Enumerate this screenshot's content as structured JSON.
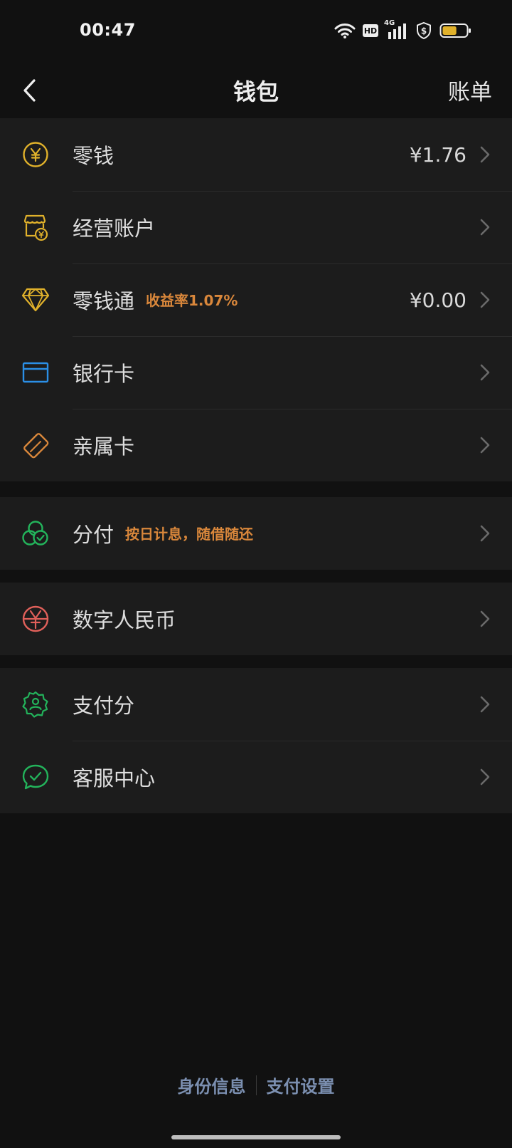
{
  "status_bar": {
    "time": "00:47",
    "hd": "HD",
    "network": "4G",
    "battery_level": 0.6,
    "colors": {
      "battery_fill": "#e0b12b"
    }
  },
  "nav": {
    "title": "钱包",
    "right_action": "账单"
  },
  "groups": [
    {
      "rows": [
        {
          "label": "零钱",
          "value": "¥1.76",
          "icon": "coin-yuan-icon"
        },
        {
          "label": "经营账户",
          "icon": "shop-account-icon"
        },
        {
          "label": "零钱通",
          "tag": "收益率1.07%",
          "value": "¥0.00",
          "icon": "diamond-icon"
        },
        {
          "label": "银行卡",
          "icon": "bank-card-icon"
        },
        {
          "label": "亲属卡",
          "icon": "family-card-icon"
        }
      ]
    },
    {
      "rows": [
        {
          "label": "分付",
          "tag": "按日计息，随借随还",
          "icon": "fenfu-icon"
        }
      ]
    },
    {
      "rows": [
        {
          "label": "数字人民币",
          "icon": "digital-rmb-icon"
        }
      ]
    },
    {
      "rows": [
        {
          "label": "支付分",
          "icon": "pay-score-icon"
        },
        {
          "label": "客服中心",
          "icon": "customer-service-icon"
        }
      ]
    }
  ],
  "footer": {
    "identity_info": "身份信息",
    "payment_settings": "支付设置"
  },
  "colors": {
    "background": "#111111",
    "card": "#1c1c1c",
    "gold": "#e0b12b",
    "blue": "#2b8fe6",
    "orange": "#d9873b",
    "green": "#23b35b",
    "red": "#e0605a",
    "link": "#7b8fb0"
  }
}
